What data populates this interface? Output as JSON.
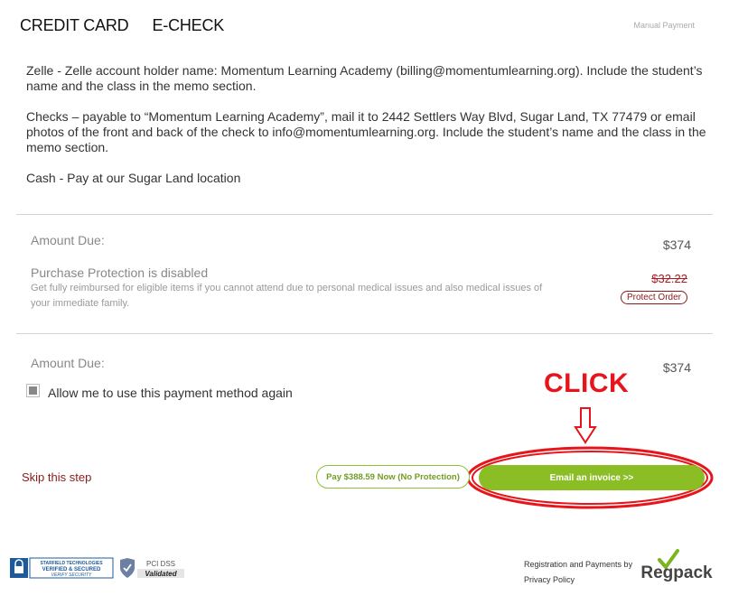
{
  "tabs": [
    "CREDIT CARD",
    "E-CHECK"
  ],
  "manual_payment_link": "Manual Payment",
  "instructions": {
    "zelle": "Zelle - Zelle account holder name: Momentum Learning Academy (billing@momentumlearning.org). Include the student’s name and the class in the memo section.",
    "checks": "Checks – payable to “Momentum Learning Academy”, mail it to 2442 Settlers Way Blvd, Sugar Land, TX 77479 or email photos of the front and back of the check to info@momentumlearning.org. Include the student’s name and the class in the memo section.",
    "cash": "Cash - Pay at our Sugar Land location"
  },
  "summary": {
    "amount_due_label": "Amount Due:",
    "amount_due_value": "$374",
    "protection_label": "Purchase Protection is disabled",
    "protection_note": "Get fully reimbursed for eligible items if you cannot attend due to personal medical issues and also medical issues of your immediate family.",
    "protection_price": "$32.22",
    "protect_order_button": "Protect Order"
  },
  "total": {
    "amount_due_label": "Amount Due:",
    "amount_due_value": "$374",
    "allow_reuse_label": "Allow me to use this payment method again",
    "allow_reuse_checked": true
  },
  "annotation": {
    "click_text": "CLICK",
    "color": "#e8141b"
  },
  "actions": {
    "skip_step": "Skip this step",
    "pay_now": "Pay $388.59 Now (No Protection)",
    "email_invoice": "Email an invoice >>"
  },
  "footer": {
    "starfield_badge": {
      "line1": "STARFIELD TECHNOLOGIES",
      "line2": "VERIFIED & SECURED",
      "line3": "VERIFY SECURITY"
    },
    "pci_badge": {
      "line1": "PCI DSS",
      "line2": "Validated"
    },
    "registration_text": "Registration and Payments by",
    "privacy_policy": "Privacy Policy",
    "regpack_logo": "Regpack"
  },
  "colors": {
    "accent_green": "#8bbd24",
    "link_red": "#8b1a1a",
    "strike_red": "#a61c24"
  }
}
